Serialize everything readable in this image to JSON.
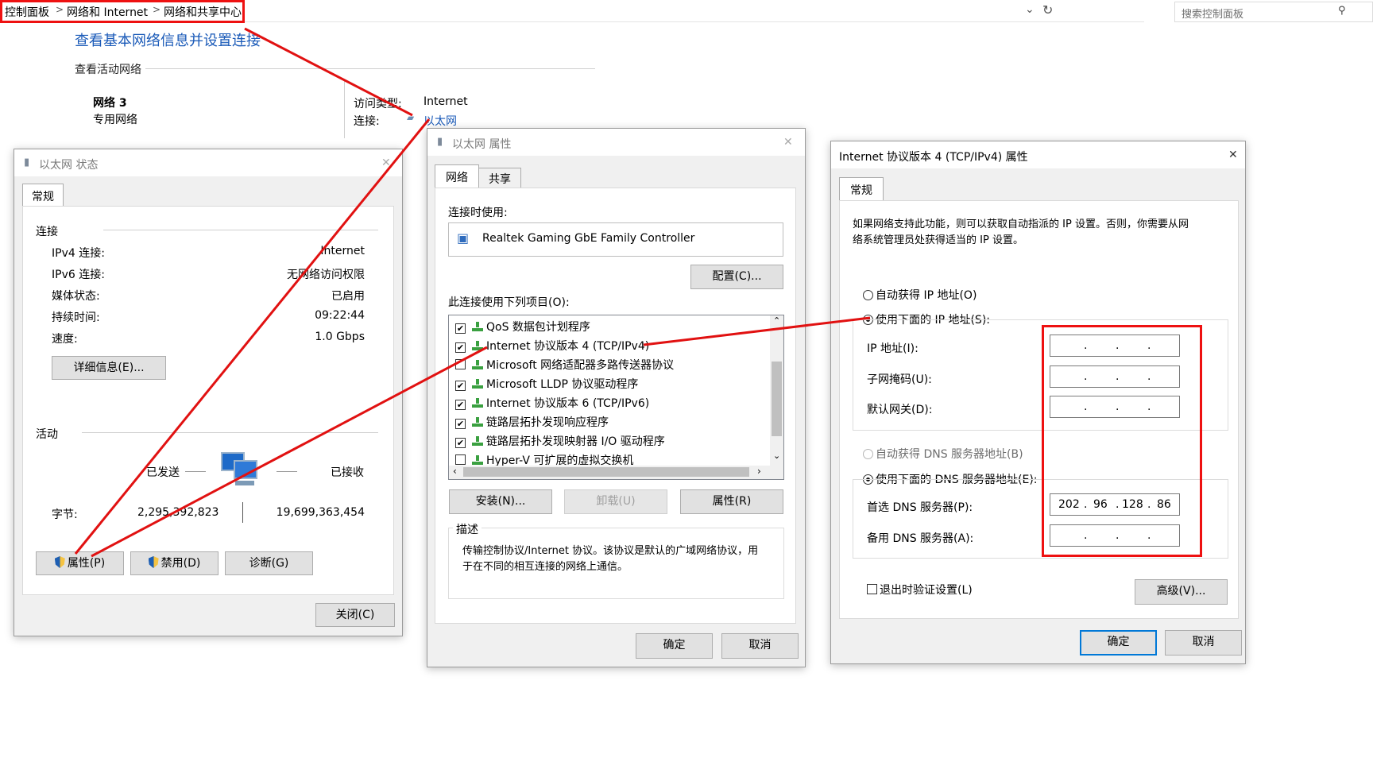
{
  "breadcrumb": {
    "items": [
      "控制面板",
      "网络和 Internet",
      "网络和共享中心"
    ],
    "separator": ">",
    "search_placeholder": "搜索控制面板"
  },
  "main": {
    "title": "查看基本网络信息并设置连接",
    "active_networks_label": "查看活动网络",
    "network_name": "网络 3",
    "network_type": "专用网络",
    "access_type_label": "访问类型:",
    "access_type_value": "Internet",
    "connection_label": "连接:",
    "connection_value": "以太网"
  },
  "status_dialog": {
    "title": "以太网 状态",
    "tab": "常规",
    "connection_section": "连接",
    "rows": [
      {
        "label": "IPv4 连接:",
        "value": "Internet"
      },
      {
        "label": "IPv6 连接:",
        "value": "无网络访问权限"
      },
      {
        "label": "媒体状态:",
        "value": "已启用"
      },
      {
        "label": "持续时间:",
        "value": "09:22:44"
      },
      {
        "label": "速度:",
        "value": "1.0 Gbps"
      }
    ],
    "details_button": "详细信息(E)...",
    "activity_section": "活动",
    "sent_label": "已发送",
    "received_label": "已接收",
    "bytes_label": "字节:",
    "bytes_sent": "2,295,392,823",
    "bytes_received": "19,699,363,454",
    "properties_button": "属性(P)",
    "disable_button": "禁用(D)",
    "diagnose_button": "诊断(G)",
    "close_button": "关闭(C)"
  },
  "props_dialog": {
    "title": "以太网 属性",
    "tabs": [
      "网络",
      "共享"
    ],
    "connect_using_label": "连接时使用:",
    "adapter_name": "Realtek Gaming GbE Family Controller",
    "configure_button": "配置(C)...",
    "items_label": "此连接使用下列项目(O):",
    "items": [
      {
        "label": "QoS 数据包计划程序",
        "checked": true,
        "icon": "qos-icon"
      },
      {
        "label": "Internet 协议版本 4 (TCP/IPv4)",
        "checked": true,
        "icon": "protocol-icon"
      },
      {
        "label": "Microsoft 网络适配器多路传送器协议",
        "checked": false,
        "icon": "protocol-icon"
      },
      {
        "label": "Microsoft LLDP 协议驱动程序",
        "checked": true,
        "icon": "protocol-icon"
      },
      {
        "label": "Internet 协议版本 6 (TCP/IPv6)",
        "checked": true,
        "icon": "protocol-icon"
      },
      {
        "label": "链路层拓扑发现响应程序",
        "checked": true,
        "icon": "protocol-icon"
      },
      {
        "label": "链路层拓扑发现映射器 I/O 驱动程序",
        "checked": true,
        "icon": "protocol-icon"
      },
      {
        "label": "Hyper-V 可扩展的虚拟交换机",
        "checked": false,
        "icon": "protocol-icon"
      }
    ],
    "install_button": "安装(N)...",
    "uninstall_button": "卸载(U)",
    "properties_button": "属性(R)",
    "description_label": "描述",
    "description_text_line1": "传输控制协议/Internet 协议。该协议是默认的广域网络协议，用",
    "description_text_line2": "于在不同的相互连接的网络上通信。",
    "ok_button": "确定",
    "cancel_button": "取消"
  },
  "ipv4_dialog": {
    "title": "Internet 协议版本 4 (TCP/IPv4) 属性",
    "tab": "常规",
    "intro_line1": "如果网络支持此功能，则可以获取自动指派的 IP 设置。否则，你需要从网",
    "intro_line2": "络系统管理员处获得适当的 IP 设置。",
    "auto_ip_label": "自动获得 IP 地址(O)",
    "manual_ip_label": "使用下面的 IP 地址(S):",
    "ip_address_label": "IP 地址(I):",
    "subnet_label": "子网掩码(U):",
    "gateway_label": "默认网关(D):",
    "auto_dns_label": "自动获得 DNS 服务器地址(B)",
    "manual_dns_label": "使用下面的 DNS 服务器地址(E):",
    "preferred_dns_label": "首选 DNS 服务器(P):",
    "alternate_dns_label": "备用 DNS 服务器(A):",
    "preferred_dns": [
      "202",
      "96",
      "128",
      "86"
    ],
    "validate_label": "退出时验证设置(L)",
    "advanced_button": "高级(V)...",
    "ok_button": "确定",
    "cancel_button": "取消",
    "ip_dot": "."
  },
  "colors": {
    "annotation_red": "#e11111",
    "link_blue": "#1a5ab8",
    "focus_blue": "#0078d7"
  }
}
